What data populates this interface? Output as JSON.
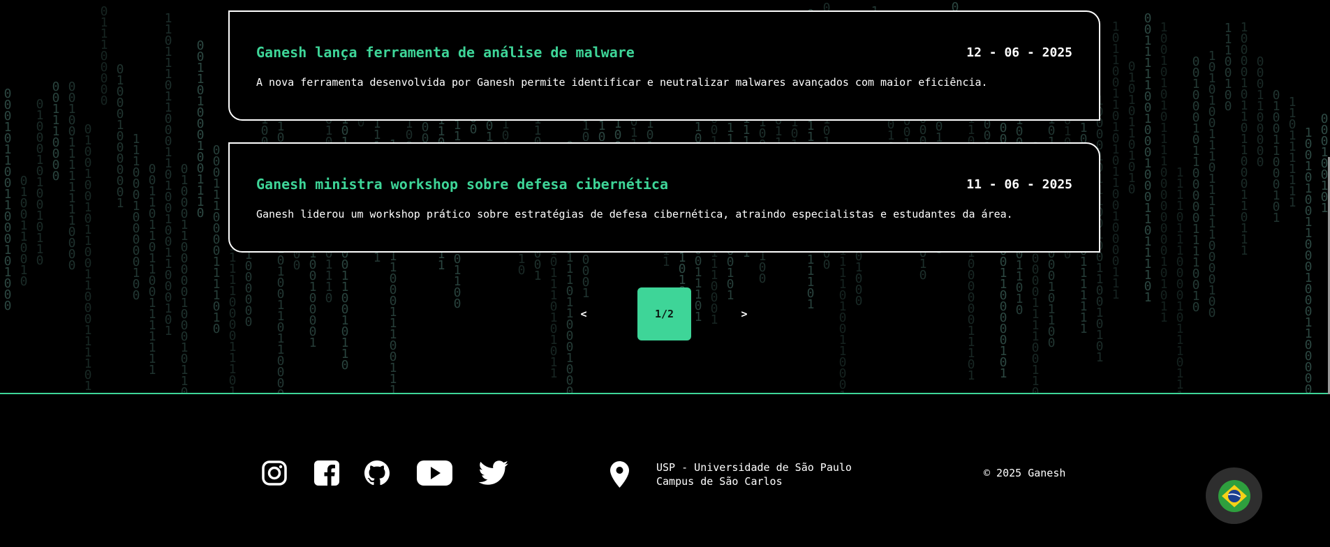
{
  "news": [
    {
      "title": "Ganesh lança ferramenta de análise de malware",
      "date": "12 - 06 - 2025",
      "description": "A nova ferramenta desenvolvida por Ganesh permite identificar e neutralizar malwares avançados com maior eficiência."
    },
    {
      "title": "Ganesh ministra workshop sobre defesa cibernética",
      "date": "11 - 06 - 2025",
      "description": "Ganesh liderou um workshop prático sobre estratégias de defesa cibernética, atraindo especialistas e estudantes da área."
    }
  ],
  "pagination": {
    "prev_label": "<",
    "current_label": "1/2",
    "next_label": ">"
  },
  "footer": {
    "social_icons": [
      "instagram-icon",
      "facebook-icon",
      "github-icon",
      "youtube-icon",
      "twitter-icon"
    ],
    "address_line1": "USP - Universidade de São Paulo",
    "address_line2": "Campus de São Carlos",
    "copyright": "© 2025 Ganesh",
    "language_icon": "brazil-flag-icon"
  },
  "colors": {
    "accent": "#3ed598",
    "background": "#000000",
    "matrix_digits": "#2e4a44"
  }
}
